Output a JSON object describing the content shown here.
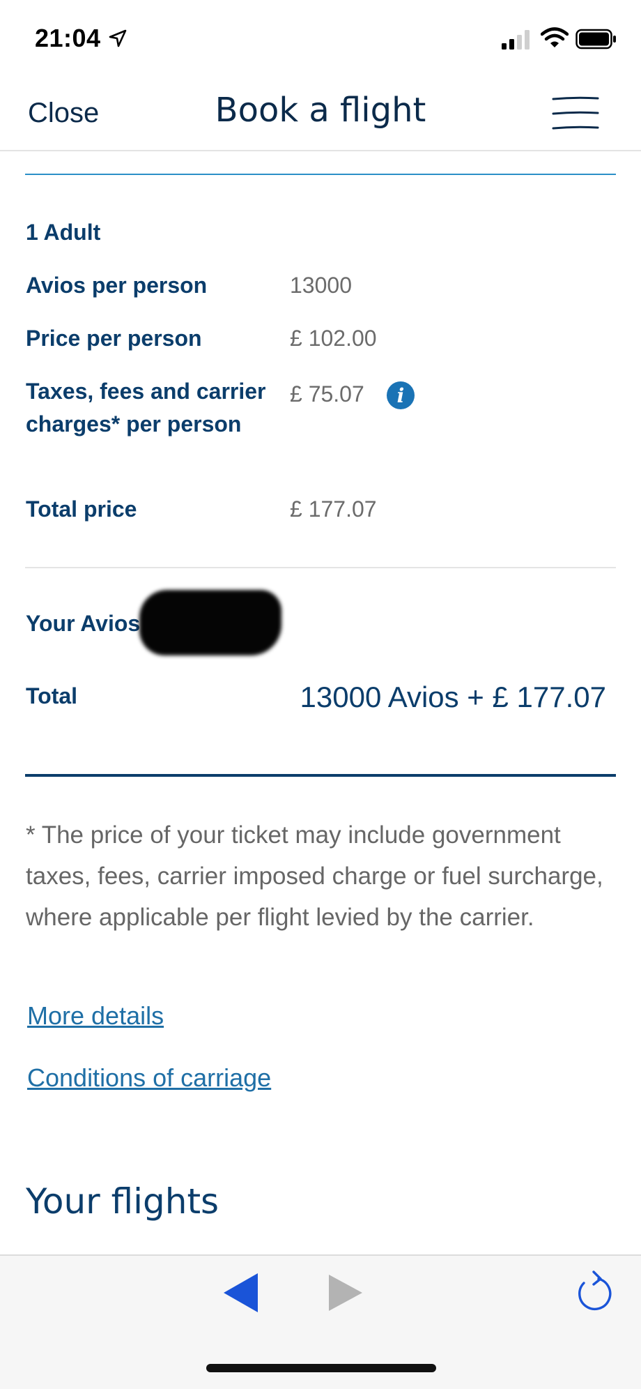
{
  "status_bar": {
    "time": "21:04"
  },
  "header": {
    "close_label": "Close",
    "title": "Book a flight"
  },
  "pricing": {
    "passengers_label": "1 Adult",
    "rows": [
      {
        "label": "Avios per person",
        "value": "13000"
      },
      {
        "label": "Price per person",
        "value": "£ 102.00"
      },
      {
        "label": "Taxes, fees and carrier charges* per person",
        "value": "£ 75.07"
      },
      {
        "label": "Total price",
        "value": "£ 177.07"
      }
    ]
  },
  "avios": {
    "label": "Your Avios"
  },
  "total": {
    "label": "Total",
    "value": "13000 Avios +  £ 177.07"
  },
  "disclaimer": "* The price of your ticket may include government taxes, fees, carrier imposed charge or fuel surcharge, where applicable per flight levied by the carrier.",
  "links": {
    "more_details": "More details",
    "conditions": "Conditions of carriage"
  },
  "section": {
    "your_flights": "Your flights"
  },
  "icons": {
    "location": "location-arrow-icon",
    "signal": "cellular-signal-icon",
    "wifi": "wifi-icon",
    "battery": "battery-icon",
    "menu": "hamburger-menu-icon",
    "info": "info-icon",
    "back": "back-arrow-icon",
    "forward": "forward-arrow-icon",
    "reload": "reload-icon"
  },
  "colors": {
    "brand_navy": "#0b3d6b",
    "link_blue": "#1f6fa6",
    "accent_blue": "#2b8fc7",
    "nav_active": "#1a54d8",
    "nav_disabled": "#b3b3b3"
  }
}
